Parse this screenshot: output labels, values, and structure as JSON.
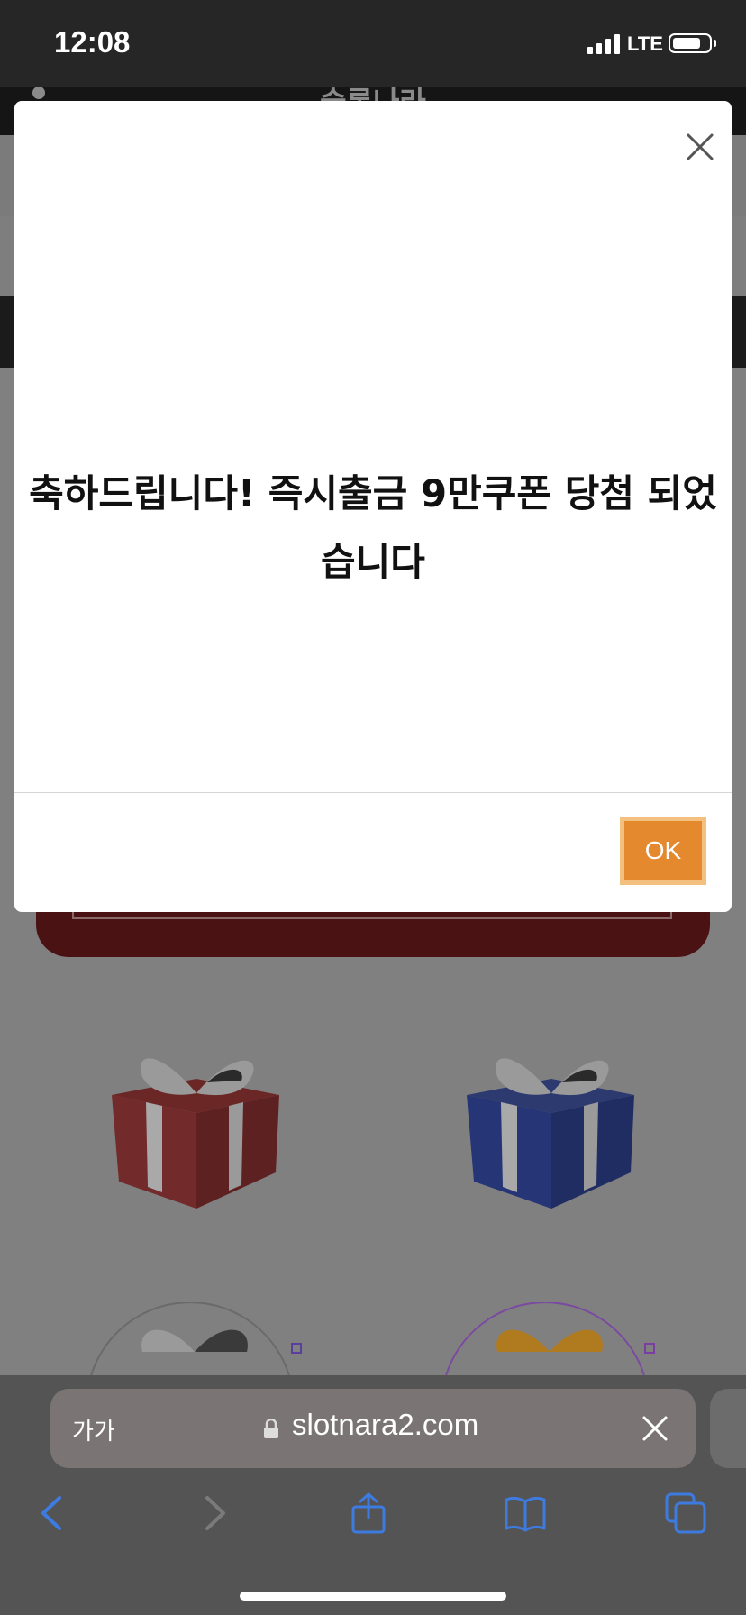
{
  "status_bar": {
    "time": "12:08",
    "network": "LTE"
  },
  "site": {
    "logo_text": "슬롯나라"
  },
  "modal": {
    "message": "축하드립니다! 즉시출금 9만쿠폰 당첨 되었습니다",
    "ok_label": "OK"
  },
  "browser": {
    "text_size_label": "가가",
    "url": "slotnara2.com"
  },
  "colors": {
    "ok_button": "#e5892f",
    "ok_button_border": "#f3c07f",
    "browser_accent": "#3d7be0"
  },
  "icons": [
    "close-icon",
    "lock-icon",
    "back-icon",
    "forward-icon",
    "share-icon",
    "bookmarks-icon",
    "tabs-icon",
    "user-icon",
    "gift-icon"
  ]
}
